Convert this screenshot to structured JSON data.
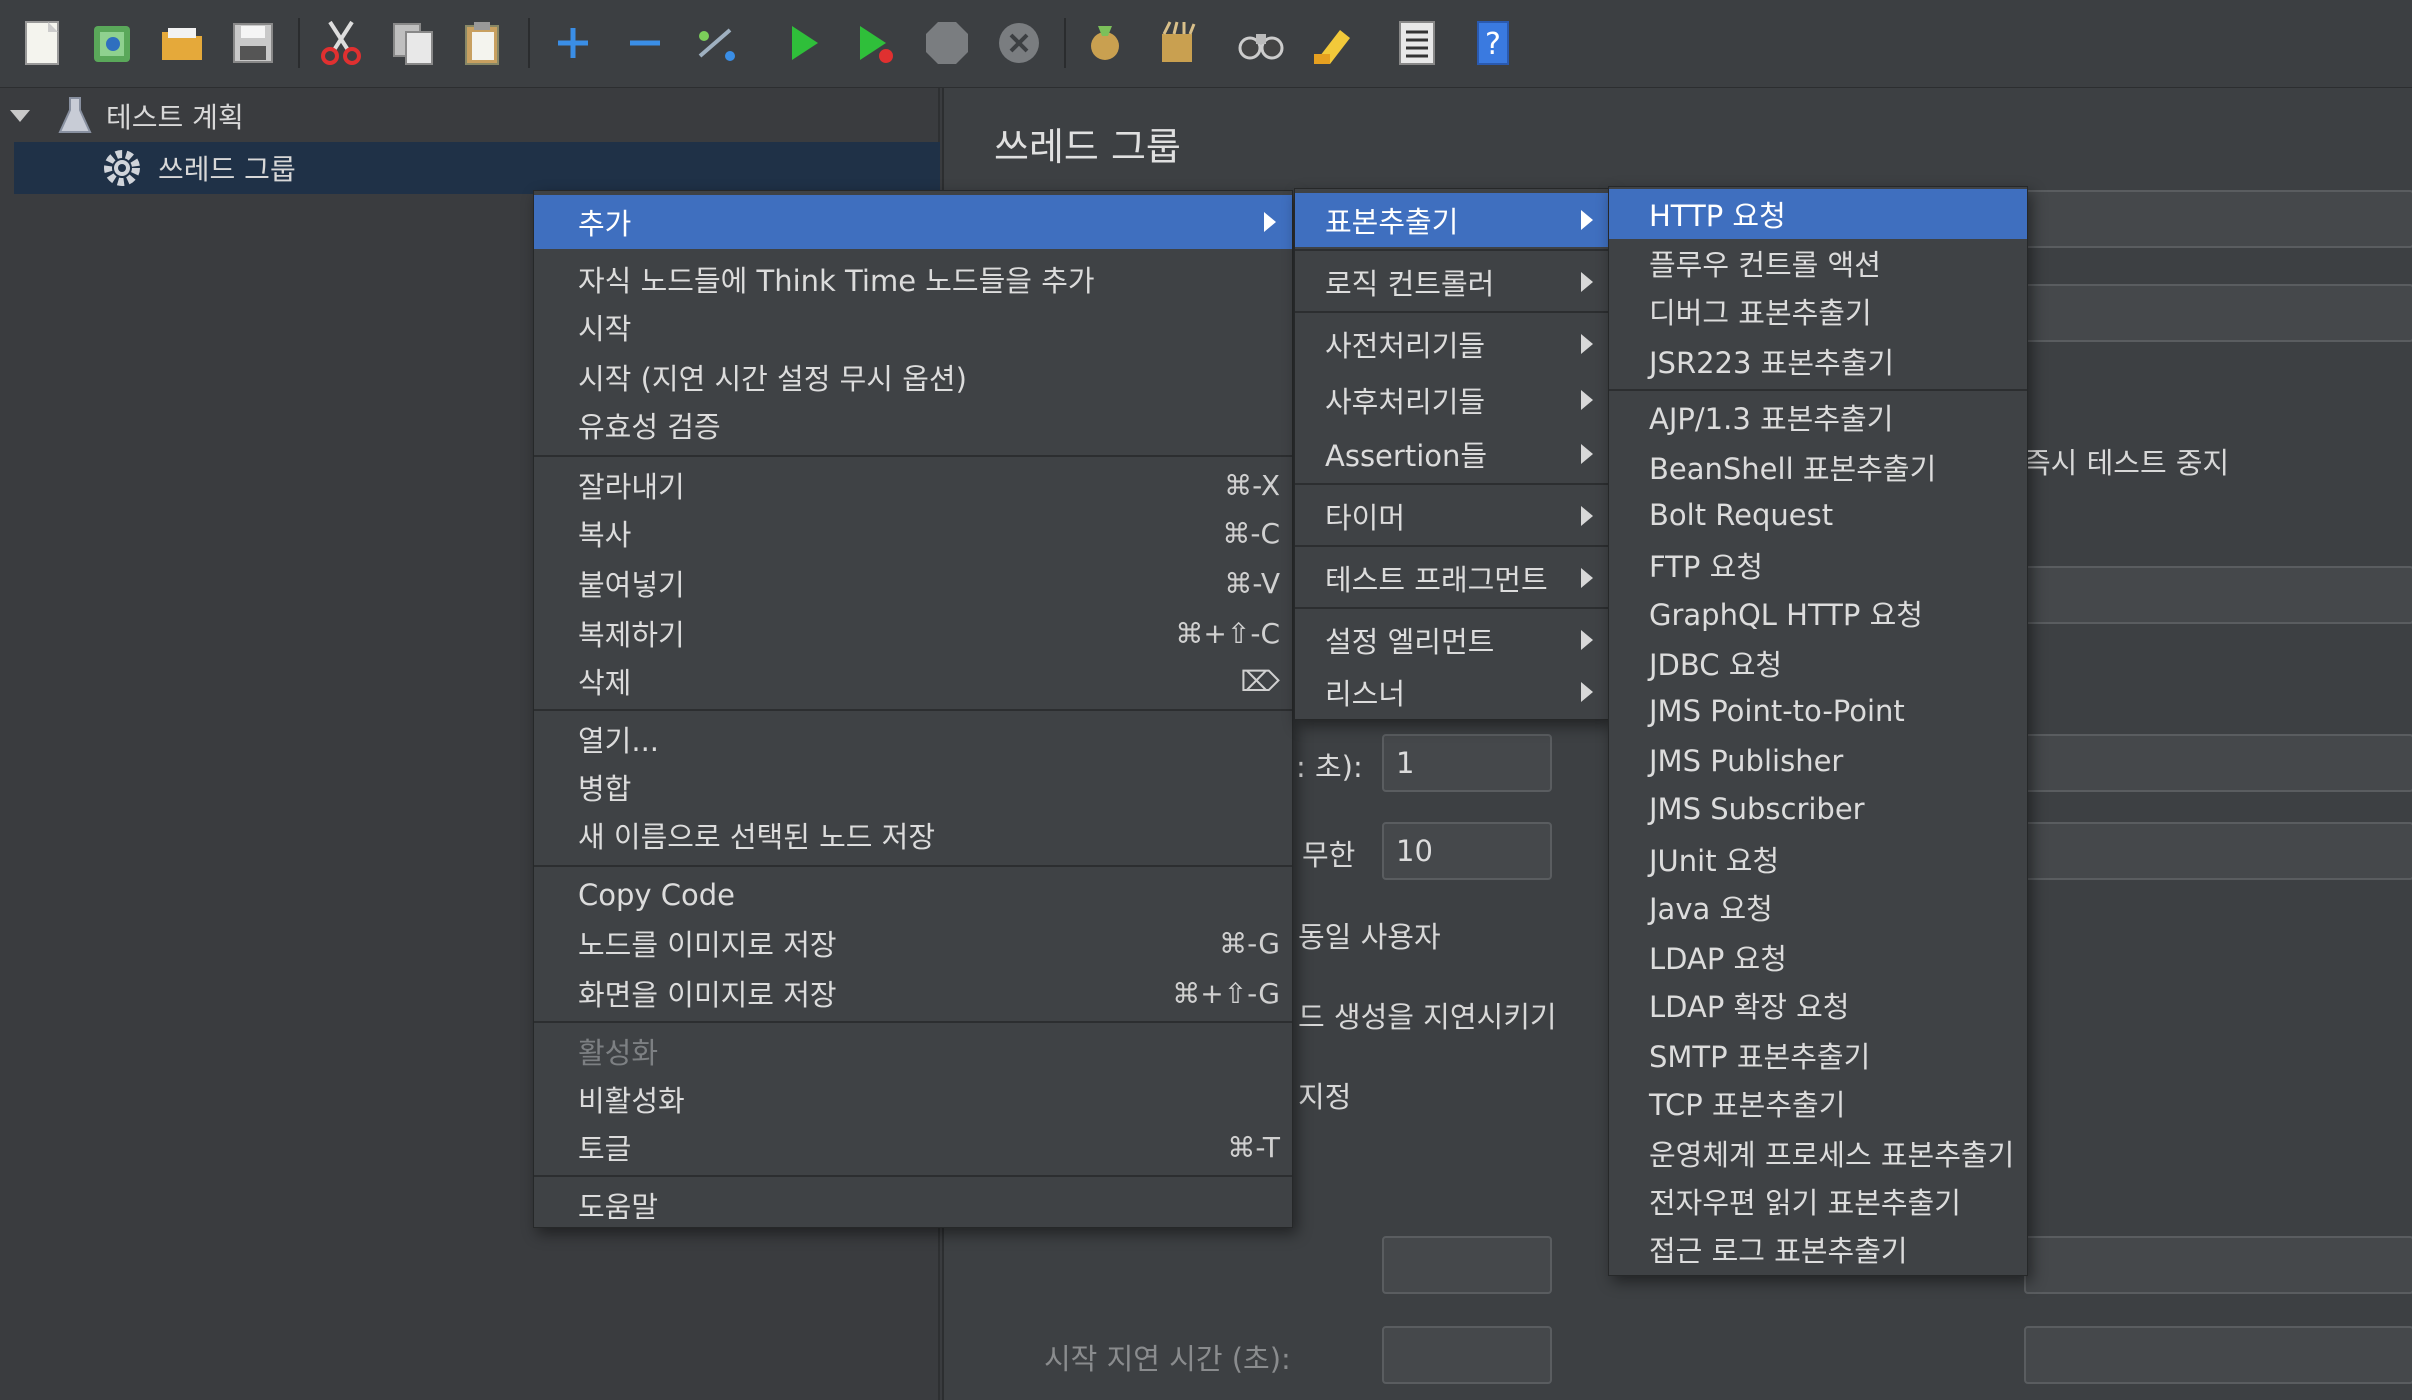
{
  "tree": {
    "root_label": "테스트 계획",
    "child_label": "쓰레드 그룹"
  },
  "panel": {
    "title": "쓰레드 그룹",
    "partial_stop_text": "즉시 테스트 중지",
    "ramp_label_partial": ": 초):",
    "ramp_value": "1",
    "loop_label_partial": "무한",
    "loop_value": "10",
    "same_user_partial": "동일 사용자",
    "delay_create_partial": "드 생성을 지연시키기",
    "specify_partial": "지정",
    "start_delay_label": "시작 지연 시간 (초):"
  },
  "context_menu": {
    "items": [
      {
        "label": "추가",
        "submenu": true,
        "highlighted": true
      },
      {
        "label": "자식 노드들에 Think Time 노드들을 추가"
      },
      {
        "label": "시작"
      },
      {
        "label": "시작 (지연 시간 설정 무시 옵션)"
      },
      {
        "label": "유효성 검증"
      },
      {
        "label": "잘라내기",
        "shortcut": "⌘-X"
      },
      {
        "label": "복사",
        "shortcut": "⌘-C"
      },
      {
        "label": "붙여넣기",
        "shortcut": "⌘-V"
      },
      {
        "label": "복제하기",
        "shortcut": "⌘+⇧-C"
      },
      {
        "label": "삭제",
        "shortcut": "⌦"
      },
      {
        "label": "열기..."
      },
      {
        "label": "병합"
      },
      {
        "label": "새 이름으로 선택된 노드 저장"
      },
      {
        "label": "Copy Code"
      },
      {
        "label": "노드를 이미지로 저장",
        "shortcut": "⌘-G"
      },
      {
        "label": "화면을 이미지로 저장",
        "shortcut": "⌘+⇧-G"
      },
      {
        "label": "활성화",
        "disabled": true
      },
      {
        "label": "비활성화"
      },
      {
        "label": "토글",
        "shortcut": "⌘-T"
      },
      {
        "label": "도움말"
      }
    ]
  },
  "add_submenu": {
    "items": [
      {
        "label": "표본추출기",
        "highlighted": true
      },
      {
        "label": "로직 컨트롤러"
      },
      {
        "label": "사전처리기들"
      },
      {
        "label": "사후처리기들"
      },
      {
        "label": "Assertion들"
      },
      {
        "label": "타이머"
      },
      {
        "label": "테스트 프래그먼트"
      },
      {
        "label": "설정 엘리먼트"
      },
      {
        "label": "리스너"
      }
    ]
  },
  "sampler_submenu": {
    "items": [
      {
        "label": "HTTP 요청",
        "highlighted": true
      },
      {
        "label": "플루우 컨트롤 액션"
      },
      {
        "label": "디버그 표본추출기"
      },
      {
        "label": "JSR223 표본추출기"
      },
      {
        "label": "AJP/1.3 표본추출기"
      },
      {
        "label": "BeanShell 표본추출기"
      },
      {
        "label": "Bolt Request"
      },
      {
        "label": "FTP 요청"
      },
      {
        "label": "GraphQL HTTP 요청"
      },
      {
        "label": "JDBC 요청"
      },
      {
        "label": "JMS Point-to-Point"
      },
      {
        "label": "JMS Publisher"
      },
      {
        "label": "JMS Subscriber"
      },
      {
        "label": "JUnit 요청"
      },
      {
        "label": "Java 요청"
      },
      {
        "label": "LDAP 요청"
      },
      {
        "label": "LDAP 확장 요청"
      },
      {
        "label": "SMTP 표본추출기"
      },
      {
        "label": "TCP 표본추출기"
      },
      {
        "label": "운영체계 프로세스 표본추출기"
      },
      {
        "label": "전자우편 읽기 표본추출기"
      },
      {
        "label": "접근 로그 표본추출기"
      }
    ]
  },
  "colors": {
    "highlight": "#3f6fbf",
    "tree_selection": "#1f3147",
    "background": "#3a3c3f"
  }
}
